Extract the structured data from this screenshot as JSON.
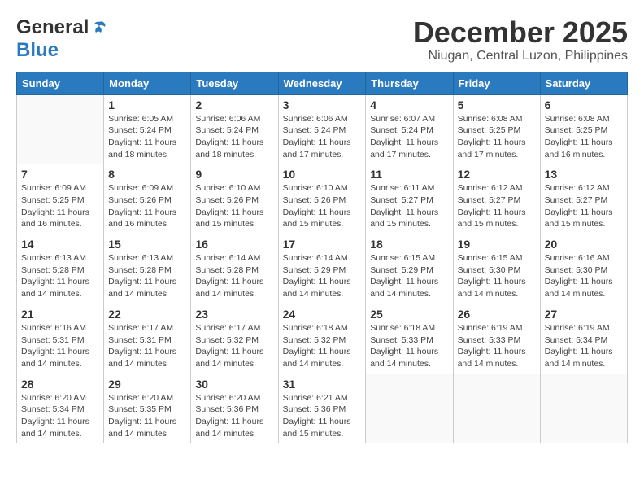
{
  "logo": {
    "general": "General",
    "blue": "Blue"
  },
  "title": "December 2025",
  "location": "Niugan, Central Luzon, Philippines",
  "days_header": [
    "Sunday",
    "Monday",
    "Tuesday",
    "Wednesday",
    "Thursday",
    "Friday",
    "Saturday"
  ],
  "weeks": [
    [
      {
        "day": "",
        "info": ""
      },
      {
        "day": "1",
        "info": "Sunrise: 6:05 AM\nSunset: 5:24 PM\nDaylight: 11 hours\nand 18 minutes."
      },
      {
        "day": "2",
        "info": "Sunrise: 6:06 AM\nSunset: 5:24 PM\nDaylight: 11 hours\nand 18 minutes."
      },
      {
        "day": "3",
        "info": "Sunrise: 6:06 AM\nSunset: 5:24 PM\nDaylight: 11 hours\nand 17 minutes."
      },
      {
        "day": "4",
        "info": "Sunrise: 6:07 AM\nSunset: 5:24 PM\nDaylight: 11 hours\nand 17 minutes."
      },
      {
        "day": "5",
        "info": "Sunrise: 6:08 AM\nSunset: 5:25 PM\nDaylight: 11 hours\nand 17 minutes."
      },
      {
        "day": "6",
        "info": "Sunrise: 6:08 AM\nSunset: 5:25 PM\nDaylight: 11 hours\nand 16 minutes."
      }
    ],
    [
      {
        "day": "7",
        "info": "Sunrise: 6:09 AM\nSunset: 5:25 PM\nDaylight: 11 hours\nand 16 minutes."
      },
      {
        "day": "8",
        "info": "Sunrise: 6:09 AM\nSunset: 5:26 PM\nDaylight: 11 hours\nand 16 minutes."
      },
      {
        "day": "9",
        "info": "Sunrise: 6:10 AM\nSunset: 5:26 PM\nDaylight: 11 hours\nand 15 minutes."
      },
      {
        "day": "10",
        "info": "Sunrise: 6:10 AM\nSunset: 5:26 PM\nDaylight: 11 hours\nand 15 minutes."
      },
      {
        "day": "11",
        "info": "Sunrise: 6:11 AM\nSunset: 5:27 PM\nDaylight: 11 hours\nand 15 minutes."
      },
      {
        "day": "12",
        "info": "Sunrise: 6:12 AM\nSunset: 5:27 PM\nDaylight: 11 hours\nand 15 minutes."
      },
      {
        "day": "13",
        "info": "Sunrise: 6:12 AM\nSunset: 5:27 PM\nDaylight: 11 hours\nand 15 minutes."
      }
    ],
    [
      {
        "day": "14",
        "info": "Sunrise: 6:13 AM\nSunset: 5:28 PM\nDaylight: 11 hours\nand 14 minutes."
      },
      {
        "day": "15",
        "info": "Sunrise: 6:13 AM\nSunset: 5:28 PM\nDaylight: 11 hours\nand 14 minutes."
      },
      {
        "day": "16",
        "info": "Sunrise: 6:14 AM\nSunset: 5:28 PM\nDaylight: 11 hours\nand 14 minutes."
      },
      {
        "day": "17",
        "info": "Sunrise: 6:14 AM\nSunset: 5:29 PM\nDaylight: 11 hours\nand 14 minutes."
      },
      {
        "day": "18",
        "info": "Sunrise: 6:15 AM\nSunset: 5:29 PM\nDaylight: 11 hours\nand 14 minutes."
      },
      {
        "day": "19",
        "info": "Sunrise: 6:15 AM\nSunset: 5:30 PM\nDaylight: 11 hours\nand 14 minutes."
      },
      {
        "day": "20",
        "info": "Sunrise: 6:16 AM\nSunset: 5:30 PM\nDaylight: 11 hours\nand 14 minutes."
      }
    ],
    [
      {
        "day": "21",
        "info": "Sunrise: 6:16 AM\nSunset: 5:31 PM\nDaylight: 11 hours\nand 14 minutes."
      },
      {
        "day": "22",
        "info": "Sunrise: 6:17 AM\nSunset: 5:31 PM\nDaylight: 11 hours\nand 14 minutes."
      },
      {
        "day": "23",
        "info": "Sunrise: 6:17 AM\nSunset: 5:32 PM\nDaylight: 11 hours\nand 14 minutes."
      },
      {
        "day": "24",
        "info": "Sunrise: 6:18 AM\nSunset: 5:32 PM\nDaylight: 11 hours\nand 14 minutes."
      },
      {
        "day": "25",
        "info": "Sunrise: 6:18 AM\nSunset: 5:33 PM\nDaylight: 11 hours\nand 14 minutes."
      },
      {
        "day": "26",
        "info": "Sunrise: 6:19 AM\nSunset: 5:33 PM\nDaylight: 11 hours\nand 14 minutes."
      },
      {
        "day": "27",
        "info": "Sunrise: 6:19 AM\nSunset: 5:34 PM\nDaylight: 11 hours\nand 14 minutes."
      }
    ],
    [
      {
        "day": "28",
        "info": "Sunrise: 6:20 AM\nSunset: 5:34 PM\nDaylight: 11 hours\nand 14 minutes."
      },
      {
        "day": "29",
        "info": "Sunrise: 6:20 AM\nSunset: 5:35 PM\nDaylight: 11 hours\nand 14 minutes."
      },
      {
        "day": "30",
        "info": "Sunrise: 6:20 AM\nSunset: 5:36 PM\nDaylight: 11 hours\nand 14 minutes."
      },
      {
        "day": "31",
        "info": "Sunrise: 6:21 AM\nSunset: 5:36 PM\nDaylight: 11 hours\nand 15 minutes."
      },
      {
        "day": "",
        "info": ""
      },
      {
        "day": "",
        "info": ""
      },
      {
        "day": "",
        "info": ""
      }
    ]
  ]
}
